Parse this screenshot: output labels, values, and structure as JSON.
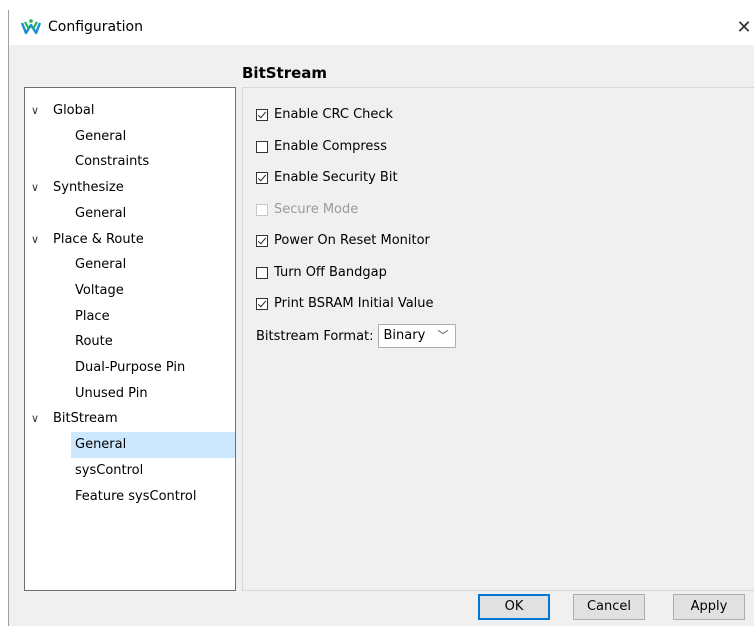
{
  "window": {
    "title": "Configuration",
    "close_icon": "close-icon"
  },
  "panel": {
    "title": "BitStream"
  },
  "tree": [
    {
      "label": "Global",
      "level": 0,
      "expanded": true
    },
    {
      "label": "General",
      "level": 1
    },
    {
      "label": "Constraints",
      "level": 1
    },
    {
      "label": "Synthesize",
      "level": 0,
      "expanded": true
    },
    {
      "label": "General",
      "level": 1
    },
    {
      "label": "Place & Route",
      "level": 0,
      "expanded": true
    },
    {
      "label": "General",
      "level": 1
    },
    {
      "label": "Voltage",
      "level": 1
    },
    {
      "label": "Place",
      "level": 1
    },
    {
      "label": "Route",
      "level": 1
    },
    {
      "label": "Dual-Purpose Pin",
      "level": 1
    },
    {
      "label": "Unused Pin",
      "level": 1
    },
    {
      "label": "BitStream",
      "level": 0,
      "expanded": true
    },
    {
      "label": "General",
      "level": 1,
      "selected": true
    },
    {
      "label": "sysControl",
      "level": 1
    },
    {
      "label": "Feature sysControl",
      "level": 1
    }
  ],
  "options": [
    {
      "label": "Enable CRC Check",
      "checked": true,
      "enabled": true
    },
    {
      "label": "Enable Compress",
      "checked": false,
      "enabled": true
    },
    {
      "label": "Enable Security Bit",
      "checked": true,
      "enabled": true
    },
    {
      "label": "Secure Mode",
      "checked": false,
      "enabled": false
    },
    {
      "label": "Power On Reset Monitor",
      "checked": true,
      "enabled": true
    },
    {
      "label": "Turn Off Bandgap",
      "checked": false,
      "enabled": true
    },
    {
      "label": "Print BSRAM Initial Value",
      "checked": true,
      "enabled": true
    }
  ],
  "format": {
    "label": "Bitstream Format:",
    "value": "Binary"
  },
  "buttons": {
    "ok": "OK",
    "cancel": "Cancel",
    "apply": "Apply"
  },
  "colors": {
    "selection": "#cce8ff",
    "default_button_border": "#0078d7"
  }
}
